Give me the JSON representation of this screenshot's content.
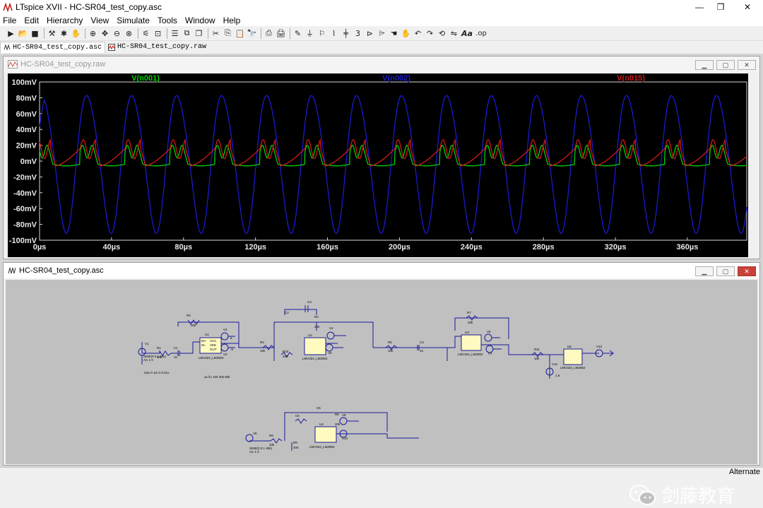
{
  "app": {
    "title": "LTspice XVII - HC-SR04_test_copy.asc",
    "controls": {
      "minimize": "—",
      "maximize": "❐",
      "close": "✕"
    }
  },
  "menu": [
    "File",
    "Edit",
    "Hierarchy",
    "View",
    "Simulate",
    "Tools",
    "Window",
    "Help"
  ],
  "toolbar": {
    "icons": [
      "new-icon",
      "open-icon",
      "save-icon",
      "control-panel-icon",
      "run-icon",
      "halt-icon",
      "zoom-in-icon",
      "zoom-full-icon",
      "zoom-out-icon",
      "zoom-cancel-icon",
      "autorange-icon",
      "tile-vertical-icon",
      "tile-horizontal-icon",
      "cascade-icon",
      "cut-icon",
      "copy-icon",
      "paste-icon",
      "find-icon",
      "print-icon",
      "print-preview-icon",
      "draw-wire-icon",
      "ground-icon",
      "label-net-icon",
      "resistor-icon",
      "capacitor-icon",
      "inductor-icon",
      "diode-icon",
      "component-icon",
      "move-icon",
      "drag-icon",
      "undo-icon",
      "redo-icon",
      "rotate-icon",
      "mirror-icon",
      "text-icon",
      "spice-directive-icon"
    ],
    "text_buttons": {
      "text": "Aa",
      "directive": ".op"
    }
  },
  "doc_tabs": [
    {
      "label": "HC-SR04_test_copy.asc",
      "active": true
    },
    {
      "label": "HC-SR04_test_copy.raw",
      "active": false
    }
  ],
  "waveform_window": {
    "title": "HC-SR04_test_copy.raw",
    "traces": [
      {
        "name": "V(n001)",
        "color": "#00d000"
      },
      {
        "name": "V(n002)",
        "color": "#1a1ad0"
      },
      {
        "name": "V(n015)",
        "color": "#d01818"
      }
    ],
    "chart_data": {
      "type": "line",
      "y_ticks": [
        "100mV",
        "80mV",
        "60mV",
        "40mV",
        "20mV",
        "0mV",
        "-20mV",
        "-40mV",
        "-60mV",
        "-80mV",
        "-100mV"
      ],
      "x_ticks": [
        "0µs",
        "40µs",
        "80µs",
        "120µs",
        "160µs",
        "200µs",
        "240µs",
        "280µs",
        "320µs",
        "360µs"
      ],
      "x_range_us": [
        0,
        393
      ],
      "y_range_mV": [
        -100,
        100
      ],
      "period_us": 25,
      "series": [
        {
          "name": "V(n001)",
          "amplitude_mV": [
            -8,
            20
          ],
          "shape": "ringing square-ish"
        },
        {
          "name": "V(n002)",
          "amplitude_mV": [
            -85,
            93
          ],
          "shape": "sine-like"
        },
        {
          "name": "V(n015)",
          "amplitude_mV": [
            -10,
            32
          ],
          "shape": "ringing square-ish"
        }
      ]
    }
  },
  "schematic_window": {
    "title": "HC-SR04_test_copy.asc",
    "labels": {
      "v1": "V1",
      "v1_val": "SINE(0 0.1 40k)",
      "v1_ac": "AC 1 0",
      "r1": "R1",
      "r1_val": "10k",
      "c1": "C1",
      "c1_val": "1n",
      "r2": "R2",
      "r2_val": "20k",
      "u1": "U1",
      "u1_part": "LMV324_LM2902",
      "v2": "V2",
      "v3": "V3",
      "v2_val": "5",
      "v3_val": "-5",
      "r3": "R3",
      "r3_val": "10k",
      "c2": "C2",
      "c3": "C3",
      "r4": "R4",
      "r4_val": "20k",
      "r10": "R10",
      "r10_val": "200",
      "u2": "U2",
      "u2_part": "LMV324_LM2902",
      "v4": "V4",
      "v5": "V5",
      "r5": "R5",
      "r5_val": "10k",
      "c4": "C4",
      "c4_val": "1n",
      "r7": "R7",
      "r7_val": "20k",
      "u3": "U3",
      "u3_part": "LMV324_LM2902",
      "v6": "V6",
      "v7": "V7",
      "r11": "R11",
      "r11_val": "10k",
      "u5": "U5",
      "u5_part": "LMV324_LM2902",
      "v12": "V12",
      "v12_val": "1.5",
      "v13": "V13",
      "tran": ".tran 0 1m 0 0.01u",
      "ac": ".ac lin 100 20k 60k",
      "v8": "V8",
      "v8_val": "SINE(0 0.1 40k)",
      "v8_ac": "AC 1 0",
      "r8": "R8",
      "r8_val": "10k",
      "r9": "R9",
      "r9_val": "200",
      "c5": "C5",
      "c6": "C6",
      "r6": "R6",
      "r6_val": "20k",
      "u4": "U4",
      "u4_part": "LMV324_LM2902",
      "v9": "V9",
      "v10": "V10",
      "pin_vcc": "VCC",
      "pin_vee": "VEE",
      "pin_out": "OUT",
      "pin_inp": "IN+",
      "pin_inm": "IN-"
    }
  },
  "watermark": {
    "text": "剑藤教育"
  },
  "status": {
    "text": "Alternate"
  }
}
